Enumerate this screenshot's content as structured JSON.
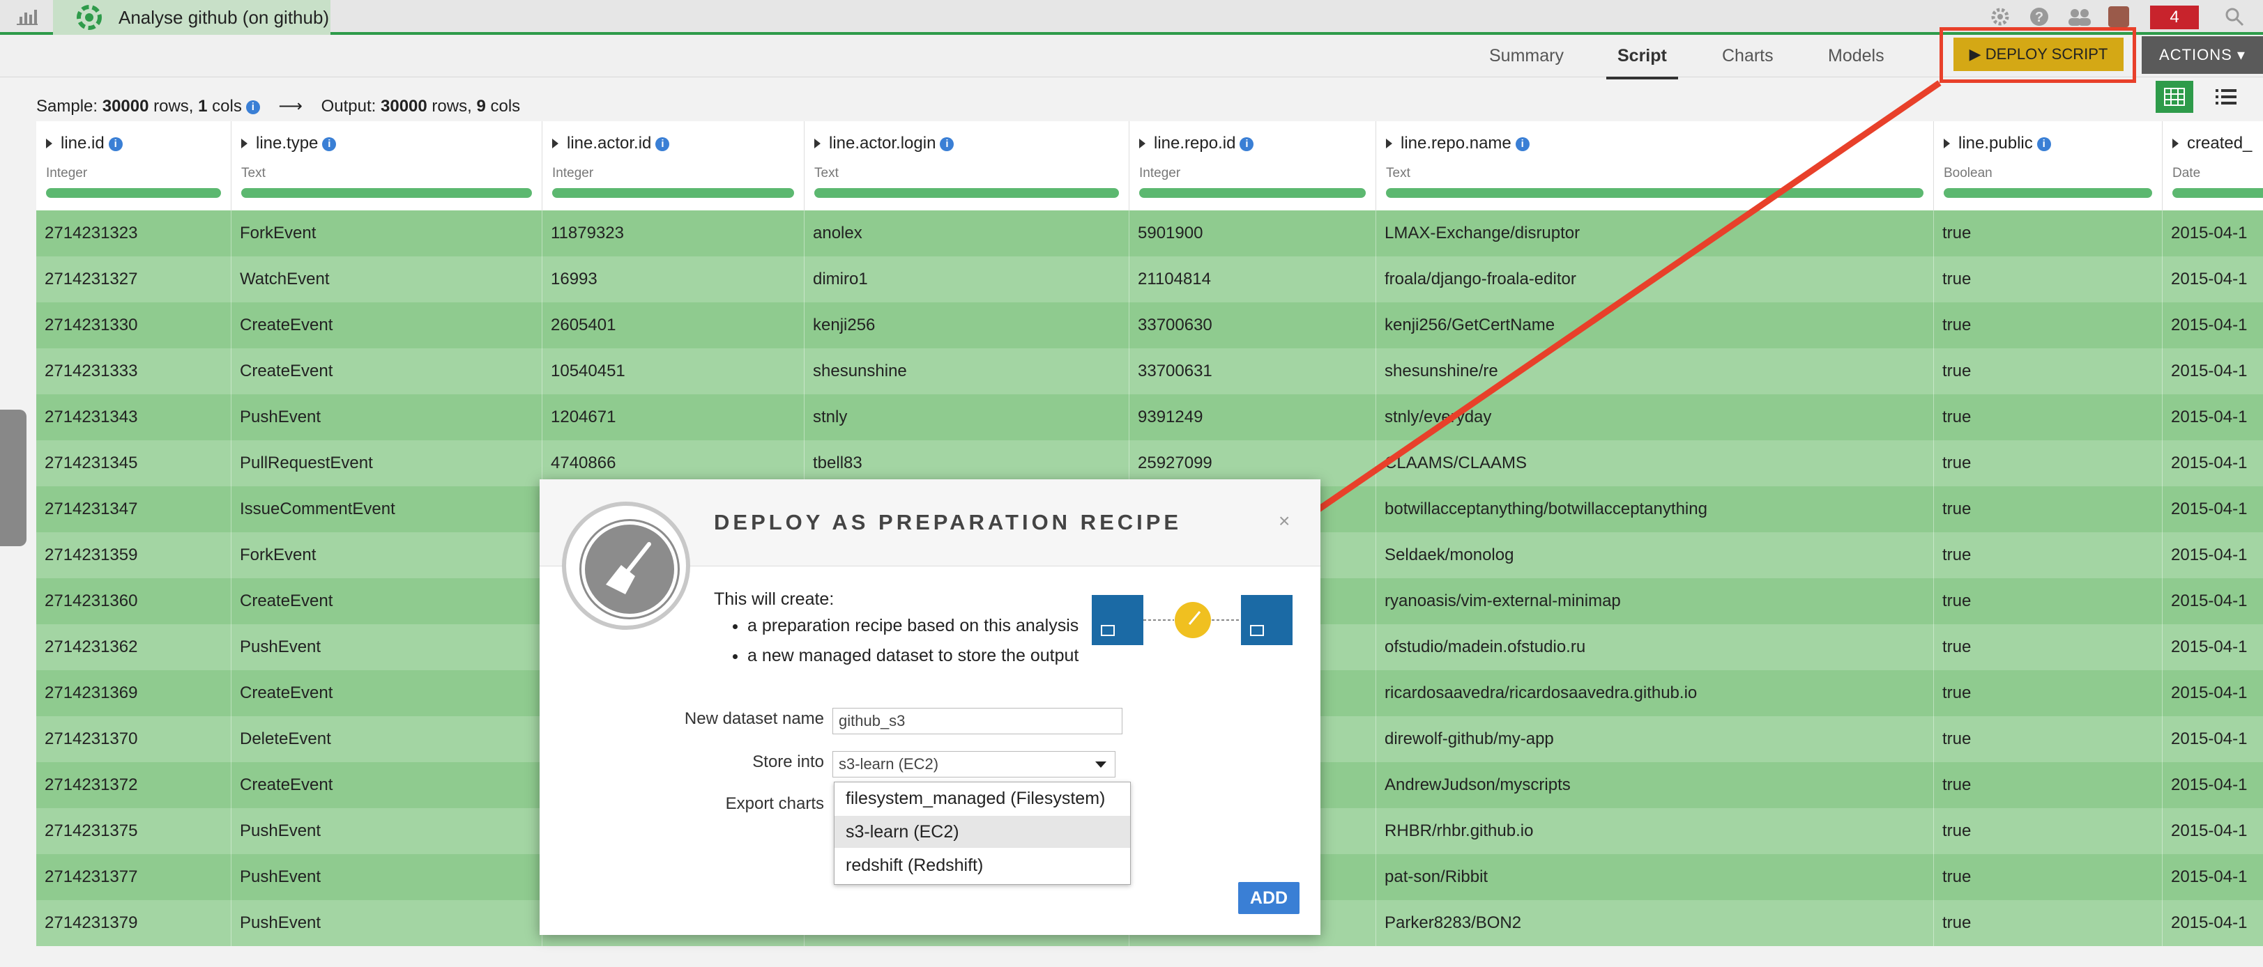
{
  "topbar": {
    "tab_title": "Analyse github (on github)",
    "badge_count": "4",
    "icons": [
      "bar-chart-icon",
      "dataiku-logo",
      "gear-icon",
      "help-icon",
      "users-icon",
      "avatar",
      "search-icon"
    ]
  },
  "subnav": {
    "tabs": [
      "Summary",
      "Script",
      "Charts",
      "Models"
    ],
    "active_tab": "Script",
    "deploy_label": "▶ DEPLOY SCRIPT",
    "actions_label": "ACTIONS ▾"
  },
  "sample": {
    "prefix": "Sample: ",
    "rows": "30000",
    "rows_suffix": " rows, ",
    "cols": "1",
    "cols_suffix": " cols",
    "arrow": "⟶",
    "output_prefix": "Output: ",
    "out_rows": "30000",
    "out_rows_suffix": " rows, ",
    "out_cols": "9",
    "out_cols_suffix": " cols"
  },
  "columns": [
    {
      "name": "line.id",
      "type": "Integer"
    },
    {
      "name": "line.type",
      "type": "Text"
    },
    {
      "name": "line.actor.id",
      "type": "Integer"
    },
    {
      "name": "line.actor.login",
      "type": "Text"
    },
    {
      "name": "line.repo.id",
      "type": "Integer"
    },
    {
      "name": "line.repo.name",
      "type": "Text"
    },
    {
      "name": "line.public",
      "type": "Boolean"
    },
    {
      "name": "created_",
      "type": "Date"
    }
  ],
  "rows": [
    [
      "2714231323",
      "ForkEvent",
      "11879323",
      "anolex",
      "5901900",
      "LMAX-Exchange/disruptor",
      "true",
      "2015-04-1"
    ],
    [
      "2714231327",
      "WatchEvent",
      "16993",
      "dimiro1",
      "21104814",
      "froala/django-froala-editor",
      "true",
      "2015-04-1"
    ],
    [
      "2714231330",
      "CreateEvent",
      "2605401",
      "kenji256",
      "33700630",
      "kenji256/GetCertName",
      "true",
      "2015-04-1"
    ],
    [
      "2714231333",
      "CreateEvent",
      "10540451",
      "shesunshine",
      "33700631",
      "shesunshine/re",
      "true",
      "2015-04-1"
    ],
    [
      "2714231343",
      "PushEvent",
      "1204671",
      "stnly",
      "9391249",
      "stnly/everyday",
      "true",
      "2015-04-1"
    ],
    [
      "2714231345",
      "PullRequestEvent",
      "4740866",
      "tbell83",
      "25927099",
      "CLAAMS/CLAAMS",
      "true",
      "2015-04-1"
    ],
    [
      "2714231347",
      "IssueCommentEvent",
      "",
      "",
      "",
      "botwillacceptanything/botwillacceptanything",
      "true",
      "2015-04-1"
    ],
    [
      "2714231359",
      "ForkEvent",
      "",
      "",
      "",
      "Seldaek/monolog",
      "true",
      "2015-04-1"
    ],
    [
      "2714231360",
      "CreateEvent",
      "",
      "",
      "",
      "ryanoasis/vim-external-minimap",
      "true",
      "2015-04-1"
    ],
    [
      "2714231362",
      "PushEvent",
      "",
      "",
      "",
      "ofstudio/madein.ofstudio.ru",
      "true",
      "2015-04-1"
    ],
    [
      "2714231369",
      "CreateEvent",
      "",
      "",
      "",
      "ricardosaavedra/ricardosaavedra.github.io",
      "true",
      "2015-04-1"
    ],
    [
      "2714231370",
      "DeleteEvent",
      "",
      "",
      "",
      "direwolf-github/my-app",
      "true",
      "2015-04-1"
    ],
    [
      "2714231372",
      "CreateEvent",
      "",
      "",
      "",
      "AndrewJudson/myscripts",
      "true",
      "2015-04-1"
    ],
    [
      "2714231375",
      "PushEvent",
      "",
      "",
      "",
      "RHBR/rhbr.github.io",
      "true",
      "2015-04-1"
    ],
    [
      "2714231377",
      "PushEvent",
      "",
      "",
      "",
      "pat-son/Ribbit",
      "true",
      "2015-04-1"
    ],
    [
      "2714231379",
      "PushEvent",
      "",
      "",
      "",
      "Parker8283/BON2",
      "true",
      "2015-04-1"
    ]
  ],
  "modal": {
    "title": "DEPLOY AS PREPARATION RECIPE",
    "close": "×",
    "intro": "This will create:",
    "bullets": [
      "a preparation recipe based on this analysis",
      "a new managed dataset to store the output"
    ],
    "dataset_label": "New dataset name",
    "dataset_value": "github_s3",
    "store_label": "Store into",
    "store_value": "s3-learn (EC2)",
    "export_label": "Export charts",
    "options": [
      "filesystem_managed (Filesystem)",
      "s3-learn (EC2)",
      "redshift (Redshift)"
    ],
    "selected_option": "s3-learn (EC2)",
    "add_label": "ADD"
  },
  "colors": {
    "accent_green": "#2e9b4a",
    "row_green": "#8fcb8f",
    "deploy_yellow": "#d4a815",
    "annotation_red": "#e8402a",
    "add_blue": "#3a7fd5"
  }
}
